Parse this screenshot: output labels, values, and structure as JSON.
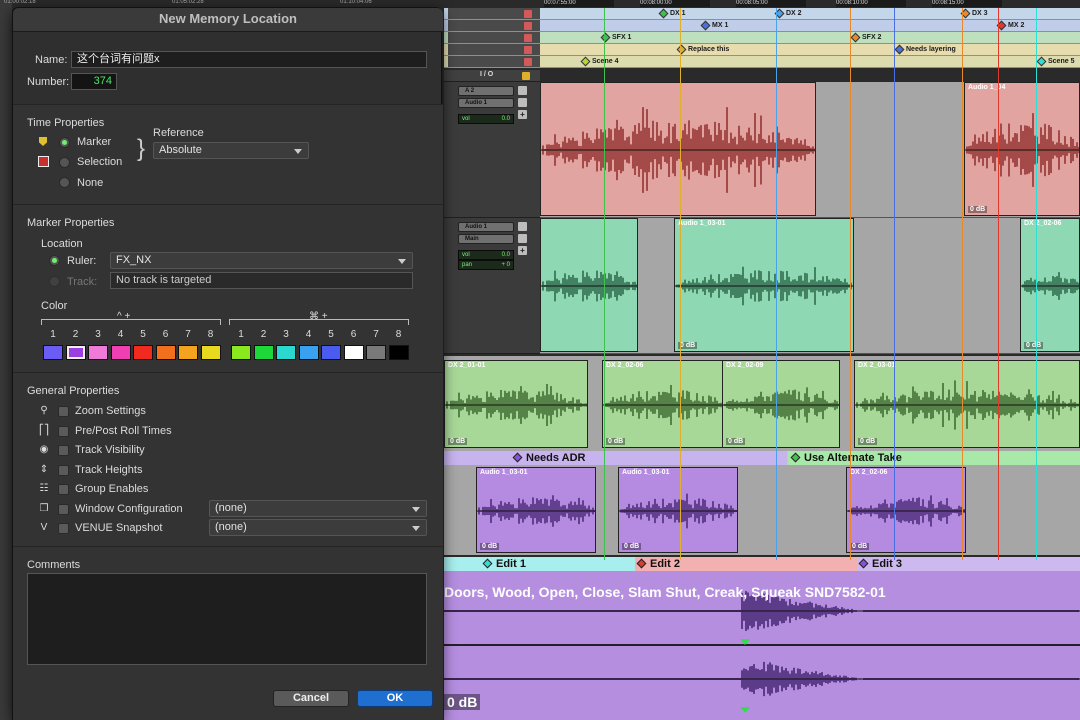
{
  "timeline": {
    "top_timecodes": [
      "01:00:02:18",
      "01:05:02:28",
      "01:10:04:06"
    ],
    "ruler_timecodes": [
      "00:07:55:00",
      "00:08:00:00",
      "00:08:05:00",
      "00:08:10:00",
      "00:08:15:00"
    ],
    "marker_rulers": [
      [
        {
          "label": "DX 1",
          "color": "#3fc24c"
        },
        {
          "label": "DX 2",
          "color": "#4aa3e8"
        },
        {
          "label": "DX 3",
          "color": "#e88a2c"
        }
      ],
      [
        {
          "label": "MX 1",
          "color": "#4a6fe0"
        },
        {
          "label": "MX 2",
          "color": "#e03a2c"
        }
      ],
      [
        {
          "label": "SFX 1",
          "color": "#3fc24c"
        },
        {
          "label": "SFX 2",
          "color": "#e88a2c"
        }
      ],
      [
        {
          "label": "Replace this",
          "color": "#e0b02c"
        },
        {
          "label": "Needs layering",
          "color": "#4a6fe0"
        }
      ],
      [
        {
          "label": "Scene 4",
          "color": "#b8d82c"
        },
        {
          "label": "Scene 5",
          "color": "#2ce0d8"
        }
      ]
    ],
    "io_header": "I / O",
    "tracks": [
      {
        "io_in": "A 2",
        "io_out": "Audio 1",
        "vol_label": "vol",
        "vol_value": "0.0"
      },
      {
        "io_in": "Audio 1",
        "io_out": "Main",
        "vol_label": "vol",
        "vol_value": "0.0",
        "pan_label": "pan",
        "pan_value": "+ 0"
      }
    ],
    "clips_track1": [
      {
        "name": "",
        "gain": ""
      },
      {
        "name": "Audio 1_04",
        "gain": "0 dB"
      }
    ],
    "clips_track2": [
      {
        "name": "",
        "gain": ""
      },
      {
        "name": "Audio 1_03-01",
        "gain": "0 dB"
      },
      {
        "name": "DX 2_02-06",
        "gain": "0 dB"
      }
    ],
    "clips_track3": [
      {
        "name": "DX 2_01-01",
        "gain": "0 dB"
      },
      {
        "name": "DX 2_02-06",
        "gain": "0 dB"
      },
      {
        "name": "DX 2_02-09",
        "gain": "0 dB"
      },
      {
        "name": "DX 2_03-01",
        "gain": "0 dB"
      }
    ],
    "marker_bar_1": [
      {
        "label": "Needs ADR",
        "color": "#8a4fe0"
      },
      {
        "label": "Use Alternate Take",
        "color": "#3fc24c"
      }
    ],
    "clips_track4": [
      {
        "name": "Audio 1_03-01",
        "gain": "0 dB"
      },
      {
        "name": "Audio 1_03-01",
        "gain": "0 dB"
      },
      {
        "name": "DX 2_02-06",
        "gain": "0 dB"
      }
    ],
    "marker_bar_2": [
      {
        "label": "Edit 1",
        "color": "#2ce0d8"
      },
      {
        "label": "Edit 2",
        "color": "#e03a2c"
      },
      {
        "label": "Edit 3",
        "color": "#8a4fe0"
      }
    ],
    "big_clip_title": "Doors, Wood, Open, Close, Slam Shut, Creak, Squeak SND7582-01",
    "big_clip_gain": "0 dB"
  },
  "dialog": {
    "title": "New Memory Location",
    "name_label": "Name:",
    "name_value": "这个台词有问题x",
    "number_label": "Number:",
    "number_value": "374",
    "time_properties": {
      "title": "Time Properties",
      "options": [
        "Marker",
        "Selection",
        "None"
      ],
      "selected": "Marker",
      "reference_label": "Reference",
      "reference_value": "Absolute"
    },
    "marker_properties": {
      "title": "Marker Properties",
      "location_label": "Location",
      "ruler_label": "Ruler:",
      "ruler_value": "FX_NX",
      "track_label": "Track:",
      "track_value": "No track is targeted",
      "color_label": "Color",
      "group1_modifier": "^ +",
      "group2_modifier": "⌘ +",
      "color_numbers": [
        "1",
        "2",
        "3",
        "4",
        "5",
        "6",
        "7",
        "8"
      ],
      "colors": [
        "#6a5cf5",
        "#9b3fe0",
        "#f07ad8",
        "#f03fb0",
        "#f02a1e",
        "#f0701e",
        "#f5a21e",
        "#e8d81e",
        "#8ae81e",
        "#1ed83a",
        "#2ad8d0",
        "#3aa0f0",
        "#4a5cf0",
        "#ffffff",
        "#7a7a7a",
        "#000000"
      ],
      "selected_color_index": 1
    },
    "general_properties": {
      "title": "General Properties",
      "items": [
        {
          "label": "Zoom Settings",
          "icon": "magnifier-icon"
        },
        {
          "label": "Pre/Post Roll Times",
          "icon": "preroll-icon"
        },
        {
          "label": "Track Visibility",
          "icon": "eye-icon"
        },
        {
          "label": "Track Heights",
          "icon": "track-height-icon"
        },
        {
          "label": "Group Enables",
          "icon": "group-icon"
        },
        {
          "label": "Window Configuration",
          "icon": "window-config-icon",
          "select": "(none)"
        },
        {
          "label": "VENUE Snapshot",
          "icon": "venue-icon",
          "select": "(none)"
        }
      ]
    },
    "comments": {
      "title": "Comments",
      "value": ""
    },
    "cancel_label": "Cancel",
    "ok_label": "OK"
  }
}
